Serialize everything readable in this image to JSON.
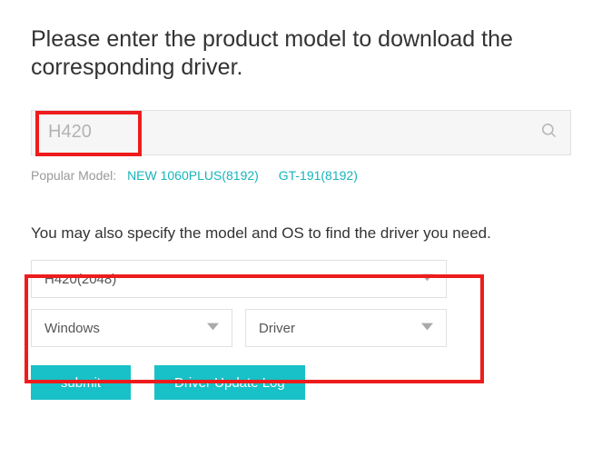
{
  "title": "Please enter the product model to download the corresponding driver.",
  "search": {
    "placeholder": "H420"
  },
  "popular": {
    "label": "Popular Model:",
    "links": [
      "NEW 1060PLUS(8192)",
      "GT-191(8192)"
    ]
  },
  "subtitle": "You may also specify the model and OS to find the driver you need.",
  "selects": {
    "model": "H420(2048)",
    "os": "Windows",
    "type": "Driver"
  },
  "buttons": {
    "submit": "submit",
    "log": "Driver Update Log"
  }
}
